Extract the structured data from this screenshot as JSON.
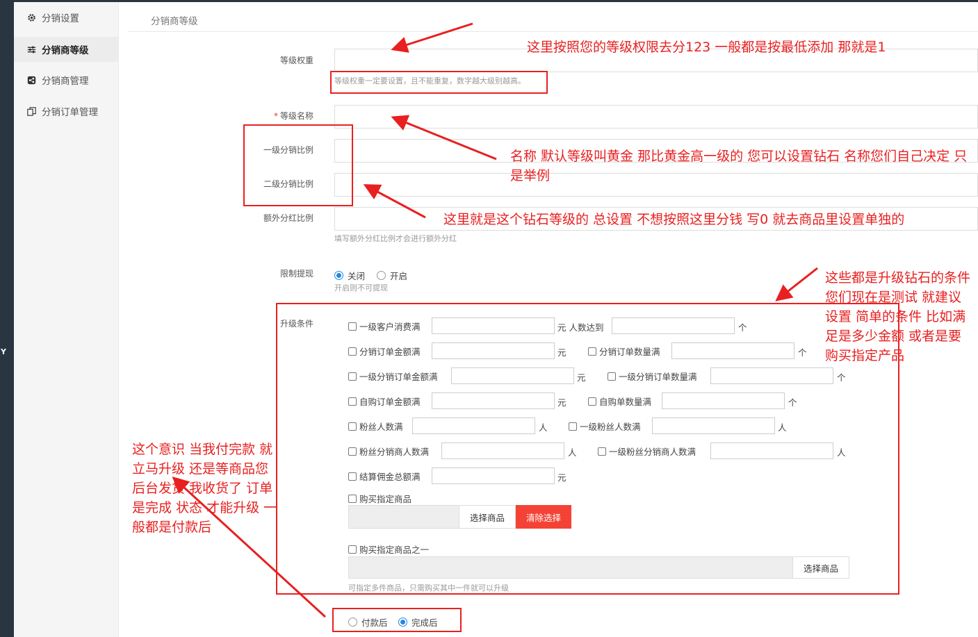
{
  "sidebar": {
    "items": [
      {
        "label": "分销设置",
        "icon": "gear-icon"
      },
      {
        "label": "分销商等级",
        "icon": "sliders-icon"
      },
      {
        "label": "分销商管理",
        "icon": "share-icon"
      },
      {
        "label": "分销订单管理",
        "icon": "copy-icon"
      }
    ],
    "active_index": 1
  },
  "left_strip_letter": "Y",
  "page_title": "分销商等级",
  "form": {
    "weight_label": "等级权重",
    "weight_hint": "等级权重一定要设置，且不能重复，数字越大级别越高。",
    "name_required_mark": "*",
    "name_label": "等级名称",
    "first_ratio_label": "一级分销比例",
    "second_ratio_label": "二级分销比例",
    "extra_ratio_label": "额外分红比例",
    "extra_hint": "填写额外分红比例才会进行额外分红",
    "withdraw_label": "限制提现",
    "withdraw_off": "关闭",
    "withdraw_on": "开启",
    "withdraw_hint": "开启则不可提现",
    "upgrade_label": "升级条件",
    "conditions": {
      "c1": "一级客户消费满",
      "c1_unit": "元 人数达到",
      "c1_unit2": "个",
      "c2": "分销订单金额满",
      "c2_unit": "元",
      "c3": "分销订单数量满",
      "c3_unit": "个",
      "c4": "一级分销订单金额满",
      "c4_unit": "元",
      "c5": "一级分销订单数量满",
      "c5_unit": "个",
      "c6": "自购订单金额满",
      "c6_unit": "元",
      "c7": "自购单数量满",
      "c7_unit": "个",
      "c8": "粉丝人数满",
      "c8_unit": "人",
      "c9": "一级粉丝人数满",
      "c9_unit": "人",
      "c10": "粉丝分销商人数满",
      "c10_unit": "人",
      "c11": "一级粉丝分销商人数满",
      "c11_unit": "人",
      "c12": "结算佣金总额满",
      "c12_unit": "元",
      "c13": "购买指定商品",
      "c14": "购买指定商品之一"
    },
    "select_goods": "选择商品",
    "clear_select": "清除选择",
    "select_goods2": "选择商品",
    "multi_hint": "可指定多件商品，只需购买其中一件就可以升级",
    "timing_after_pay": "付款后",
    "timing_after_complete": "完成后"
  },
  "annotations": {
    "n1": "这里按照您的等级权限去分123  一般都是按最低添加  那就是1",
    "n2": "名称   默认等级叫黄金   那比黄金高一级的 您可以设置钻石   名称您们自己决定  只是举例",
    "n3": "这里就是这个钻石等级的 总设置  不想按照这里分钱 写0 就去商品里设置单独的",
    "n4": "这些都是升级钻石的条件 您们现在是测试 就建议设置 简单的条件 比如满足是多少金额 或者是要购买指定产品",
    "n5": "这个意识 当我付完款 就立马升级 还是等商品您后台发货 我收货了 订单是完成 状态 才能升级 一般都是付款后"
  },
  "colors": {
    "accent": "#1e88e5",
    "danger": "#f44336",
    "annotation": "#e82020",
    "sidebar_dark": "#2a3542"
  }
}
